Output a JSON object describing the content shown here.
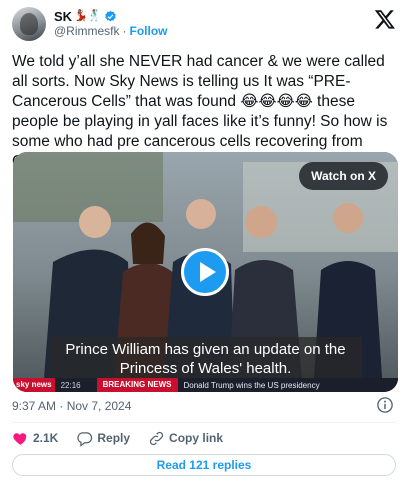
{
  "author": {
    "name": "SK",
    "name_emoji": "💃🏽🕺🏽",
    "handle": "@Rimmesfk",
    "follow_label": "Follow"
  },
  "tweet": {
    "text": "We told y’all she NEVER had cancer & we were called all sorts. Now Sky News is telling us It was “PRE-Cancerous Cells” that was found 😂😂😂😂 these people be playing in yall faces like it’s funny! So how is some who had pre cancerous cells recovering from CANCER🤔 🤔",
    "timestamp": "9:37 AM · Nov 7, 2024"
  },
  "media": {
    "watch_label": "Watch on X",
    "subtitle": "Prince William has given an update on the Princess of Wales' health.",
    "ticker": {
      "logo": "sky news",
      "time": "22:16",
      "breaking": "BREAKING NEWS",
      "headline": "Donald Trump wins the US presidency"
    }
  },
  "actions": {
    "likes": "2.1K",
    "reply_label": "Reply",
    "copy_link_label": "Copy link"
  },
  "replies_button": "Read 121 replies",
  "colors": {
    "accent": "#1d9bf0",
    "like": "#f91880",
    "muted": "#536471",
    "text": "#0f1419"
  },
  "icons": [
    "x-logo-icon",
    "verified-badge-icon",
    "play-icon",
    "info-icon",
    "heart-icon",
    "reply-icon",
    "link-icon"
  ]
}
